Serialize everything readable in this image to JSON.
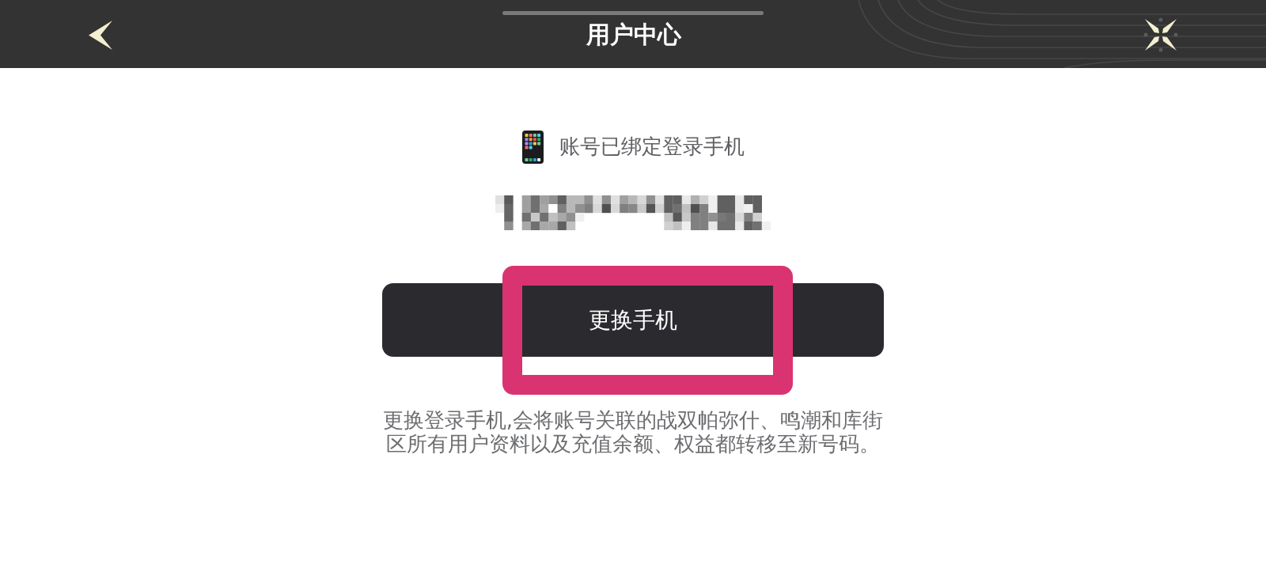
{
  "header": {
    "title": "用户中心"
  },
  "binding": {
    "label": "账号已绑定登录手机"
  },
  "button": {
    "label": "更换手机",
    "highlighted": true
  },
  "note": "更换登录手机,会将账号关联的战双帕弥什、鸣潮和库街区所有用户资料以及充值余额、权益都转移至新号码。"
}
